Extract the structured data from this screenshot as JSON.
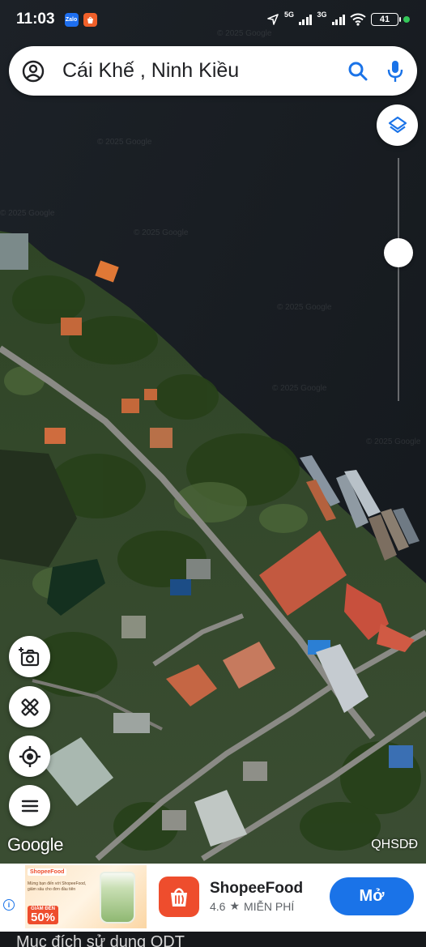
{
  "status_bar": {
    "time": "11:03",
    "apps": [
      {
        "name": "zalo-icon",
        "label": "Zalo"
      },
      {
        "name": "shopee-icon",
        "label": ""
      }
    ],
    "network_1": "5G",
    "network_2": "3G",
    "battery": "41"
  },
  "search": {
    "query": "Cái Khế , Ninh Kiều"
  },
  "map": {
    "attribution": "Google",
    "layer_label": "QHSDĐ",
    "zoom_level": 0.55,
    "watermark": "© 2025 Google"
  },
  "tools": [
    {
      "name": "add-photo-button",
      "icon": "camera-plus-icon"
    },
    {
      "name": "measure-button",
      "icon": "ruler-cross-icon"
    },
    {
      "name": "my-location-button",
      "icon": "crosshair-icon"
    },
    {
      "name": "menu-button",
      "icon": "hamburger-icon"
    }
  ],
  "ad": {
    "image_brand": "ShopeeFood",
    "image_text": "Mừng bạn đến với ShopeeFood, giảm sâu cho đơn đầu tiên",
    "image_promo_small": "GIẢM ĐẾN",
    "image_promo_big": "50%",
    "app_name": "ShopeeFood",
    "rating": "4.6",
    "price": "MIỄN PHÍ",
    "cta": "Mở"
  },
  "bottom_text": "Mục đích sử dụng  ODT",
  "colors": {
    "primary_blue": "#1a73e8",
    "shopee_orange": "#ee4d2d",
    "water": "#15191d"
  }
}
